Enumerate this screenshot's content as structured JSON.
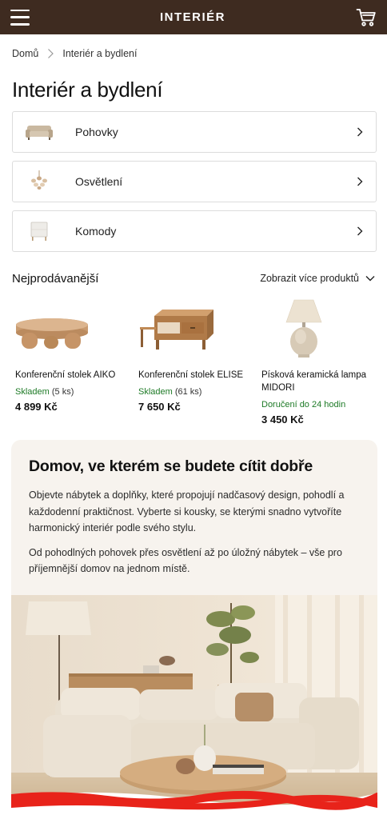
{
  "header": {
    "brand": "INTERIÉR"
  },
  "breadcrumb": {
    "home": "Domů",
    "current": "Interiér a bydlení"
  },
  "page_title": "Interiér a bydlení",
  "categories": [
    {
      "label": "Pohovky",
      "icon": "sofa-icon"
    },
    {
      "label": "Osvětlení",
      "icon": "chandelier-icon"
    },
    {
      "label": "Komody",
      "icon": "dresser-icon"
    }
  ],
  "bestsellers": {
    "title": "Nejprodávanější",
    "more_label": "Zobrazit více produktů",
    "products": [
      {
        "name": "Konferenční stolek AIKO",
        "stock": "Skladem",
        "stock_qty": " (5 ks)",
        "price": "4 899 Kč"
      },
      {
        "name": "Konferenční stolek ELISE",
        "stock": "Skladem",
        "stock_qty": " (61 ks)",
        "price": "7 650 Kč"
      },
      {
        "name": "Písková keramická lampa MIDORI",
        "stock": "Doručení do 24 hodin",
        "stock_qty": "",
        "price": "3 450 Kč"
      }
    ]
  },
  "promo": {
    "title": "Domov, ve kterém se budete cítit dobře",
    "paragraph1": "Objevte nábytek a doplňky, které propojují nadčasový design, pohodlí a každodenní praktičnost. Vyberte si kousky, se kterými snadno vytvoříte harmonický interiér podle svého stylu.",
    "paragraph2": "Od pohodlných pohovek přes osvětlení až po úložný nábytek – vše pro příjemnější domov na jednom místě."
  },
  "colors": {
    "header_bg": "#3e2b20",
    "stock_green": "#1d7a26",
    "promo_bg": "#f7f3ee",
    "scribble_red": "#e8231a"
  }
}
